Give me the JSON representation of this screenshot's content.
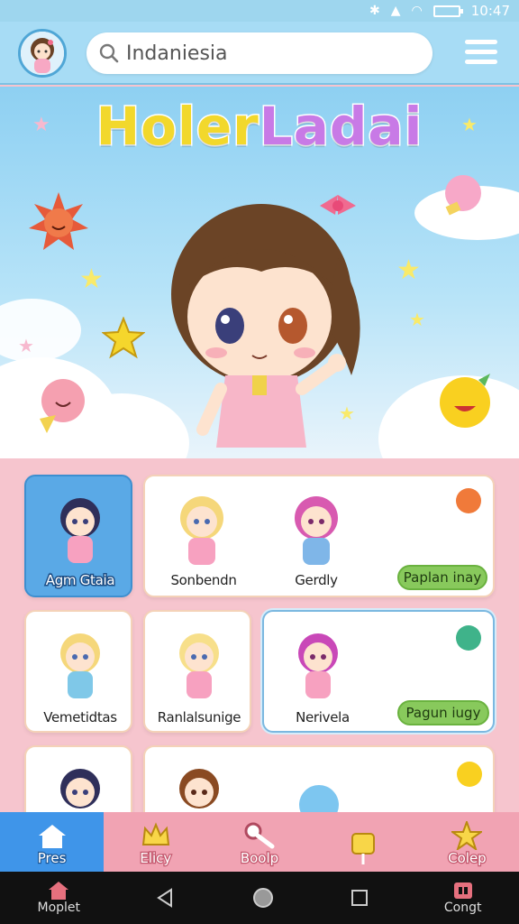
{
  "status_bar": {
    "time": "10:47"
  },
  "header": {
    "search_value": "Indaniesia",
    "icons": {
      "avatar": "avatar-icon",
      "search": "search-icon",
      "menu": "menu-icon"
    }
  },
  "hero": {
    "title": [
      "Holer",
      "Ladai"
    ],
    "colors": {
      "title_start": "#f7e23a",
      "title_end": "#b76be0"
    }
  },
  "grid": {
    "cards": [
      {
        "label": "Agm Gtaia"
      },
      {
        "label": "Sonbendn"
      },
      {
        "label": "Gerdly"
      },
      {
        "button": "Paplan inay"
      },
      {
        "label": "Vemetidtas"
      },
      {
        "label": "Ranlalsunige"
      },
      {
        "label": "Nerivela"
      },
      {
        "button": "Pagun iugy"
      }
    ]
  },
  "bottom_nav": {
    "items": [
      {
        "label": "Pres",
        "icon": "house-icon"
      },
      {
        "label": "Elicy",
        "icon": "crown-icon"
      },
      {
        "label": "Boolp",
        "icon": "key-icon"
      },
      {
        "label": "",
        "icon": "flag-icon"
      },
      {
        "label": "Colep",
        "icon": "star-icon"
      }
    ]
  },
  "system_nav": {
    "left_label": "Moplet",
    "right_label": "Congt"
  },
  "colors": {
    "accent": "#3f95e9",
    "pill_green": "#88c95c",
    "bg_pink": "#f6c5ce",
    "sky_blue": "#a7dcf5"
  }
}
